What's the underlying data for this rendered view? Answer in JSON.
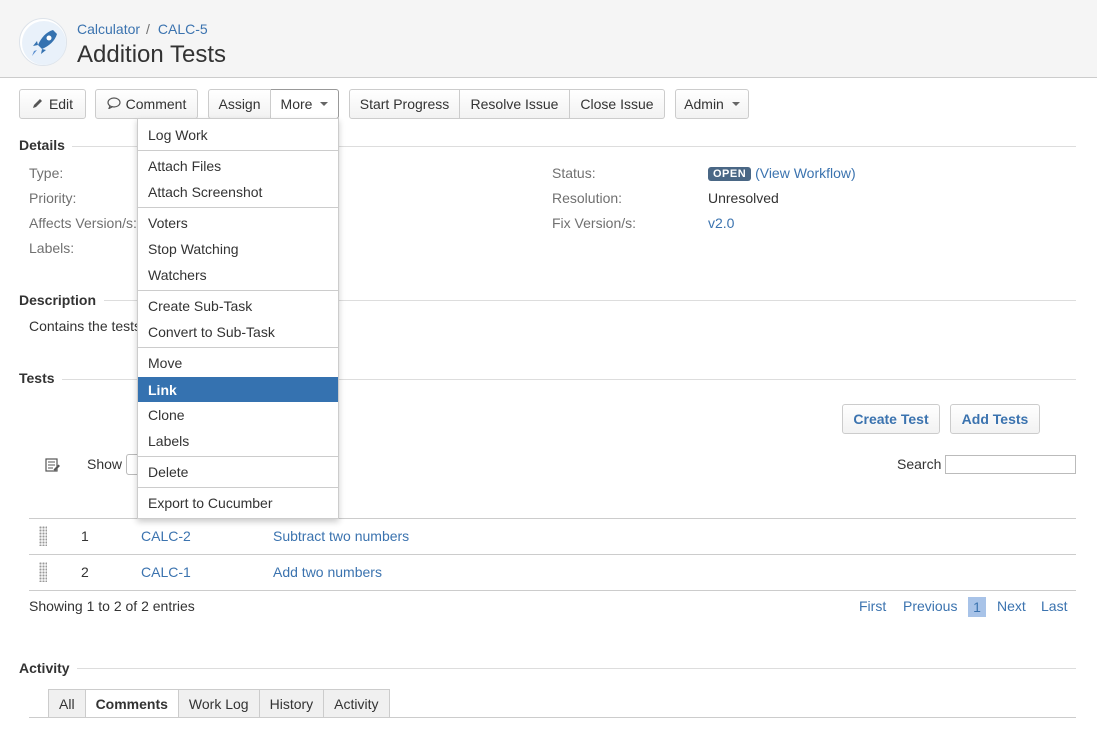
{
  "header": {
    "breadcrumb": [
      "Calculator",
      "CALC-5"
    ],
    "breadcrumb_separator": "/",
    "title": "Addition Tests"
  },
  "toolbar": {
    "edit": "Edit",
    "comment": "Comment",
    "assign": "Assign",
    "more": "More",
    "start_progress": "Start Progress",
    "resolve_issue": "Resolve Issue",
    "close_issue": "Close Issue",
    "admin": "Admin"
  },
  "more_menu": {
    "groups": [
      [
        "Log Work"
      ],
      [
        "Attach Files",
        "Attach Screenshot"
      ],
      [
        "Voters",
        "Stop Watching",
        "Watchers"
      ],
      [
        "Create Sub-Task",
        "Convert to Sub-Task"
      ],
      [
        "Move",
        "Link",
        "Clone",
        "Labels"
      ],
      [
        "Delete"
      ],
      [
        "Export to Cucumber"
      ]
    ],
    "highlighted": "Link"
  },
  "details": {
    "heading": "Details",
    "left_labels": [
      "Type:",
      "Priority:",
      "Affects Version/s:",
      "Labels:"
    ],
    "status_label": "Status:",
    "status_value": "OPEN",
    "status_link": "(View Workflow)",
    "resolution_label": "Resolution:",
    "resolution_value": "Unresolved",
    "fix_label": "Fix Version/s:",
    "fix_value": "v2.0"
  },
  "description": {
    "heading": "Description",
    "text": "Contains the tests"
  },
  "tests": {
    "heading": "Tests",
    "create_test": "Create Test",
    "add_tests": "Add Tests",
    "show_label": "Show",
    "search_label": "Search",
    "rows": [
      {
        "num": "1",
        "key": "CALC-2",
        "summary": "Subtract two numbers"
      },
      {
        "num": "2",
        "key": "CALC-1",
        "summary": "Add two numbers"
      }
    ],
    "showing": "Showing 1 to 2 of 2 entries",
    "pager": {
      "first": "First",
      "previous": "Previous",
      "current": "1",
      "next": "Next",
      "last": "Last"
    }
  },
  "activity": {
    "heading": "Activity",
    "tabs": [
      "All",
      "Comments",
      "Work Log",
      "History",
      "Activity"
    ],
    "active_tab": "Comments"
  },
  "colors": {
    "link": "#3b73af",
    "highlight": "#3572b0",
    "lozenge": "#4a6785",
    "pager_current": "#a8c3e8"
  }
}
